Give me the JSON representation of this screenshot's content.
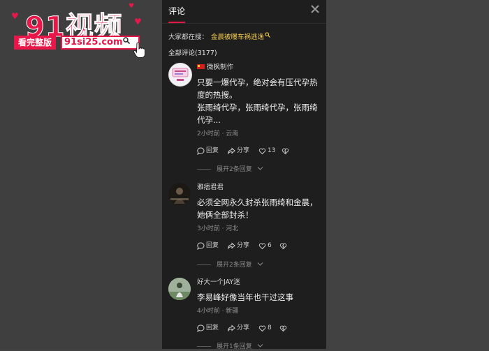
{
  "watermark": {
    "title": "91视频",
    "badge": "看完整版",
    "url": "91si25.com"
  },
  "panel": {
    "title": "评论",
    "search_hint_label": "大家都在搜：",
    "search_keyword": "金晨被曝车祸逃逸",
    "comment_count": "全部评论(3177)"
  },
  "comments": [
    {
      "author": "微枫制作",
      "avatar_text": "微枫制作",
      "text": "只要一爆代孕，绝对会有压代孕热度的热搜。\n张雨绮代孕，张雨绮代孕，张雨绮代孕...",
      "meta": "2小时前 · 云南",
      "reply": "回复",
      "share": "分享",
      "likes": "13",
      "expand": "展开2条回复"
    },
    {
      "author": "雅痞君君",
      "text": "必须全网永久封杀张雨绮和金晨，她俩全部封杀！",
      "meta": "3小时前 · 河北",
      "reply": "回复",
      "share": "分享",
      "likes": "6",
      "expand": "展开2条回复"
    },
    {
      "author": "好大一个JAY迷",
      "text": "李易峰好像当年也干过这事",
      "meta": "4小时前 · 新疆",
      "reply": "回复",
      "share": "分享",
      "likes": "8",
      "expand": "展开1条回复"
    }
  ],
  "colors": {
    "accent": "#e8174a",
    "keyword": "#f2c84b",
    "panel_bg": "#1e1e1e"
  },
  "icons": [
    "close-icon",
    "search-icon",
    "reply-icon",
    "share-icon",
    "heart-icon",
    "dislike-icon",
    "chevron-down-icon",
    "pointer-hand-icon"
  ]
}
